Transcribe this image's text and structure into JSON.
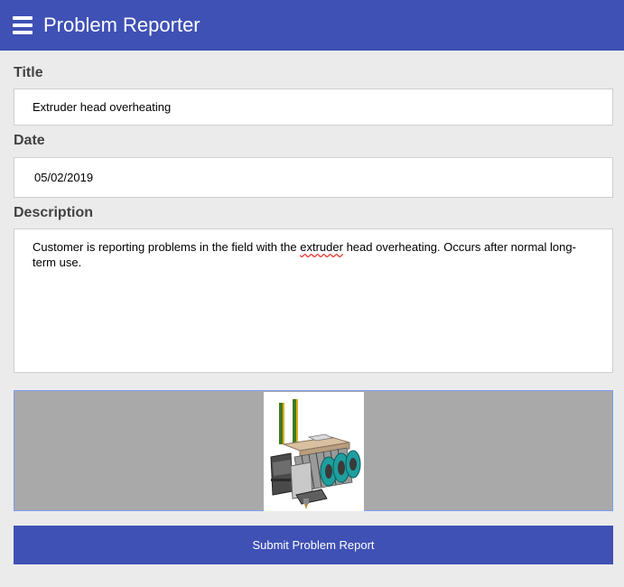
{
  "header": {
    "menu_icon": "hamburger-menu-icon",
    "title": "Problem Reporter",
    "background_color": "#3f51b5"
  },
  "form": {
    "title_label": "Title",
    "title_value": "Extruder head overheating",
    "date_label": "Date",
    "date_value": "05/02/2019",
    "description_label": "Description",
    "description_value": {
      "before": "Customer is reporting problems in the field with the ",
      "misspelled": "extruder",
      "after": " head overheating. Occurs after normal long-term use."
    }
  },
  "image": {
    "subject": "3D printer extruder head assembly"
  },
  "submit_label": "Submit Problem Report",
  "colors": {
    "accent": "#3f51b5",
    "page_background": "#ebebeb",
    "image_panel": "#a9a9a9",
    "image_panel_border": "#7b9cf0"
  }
}
